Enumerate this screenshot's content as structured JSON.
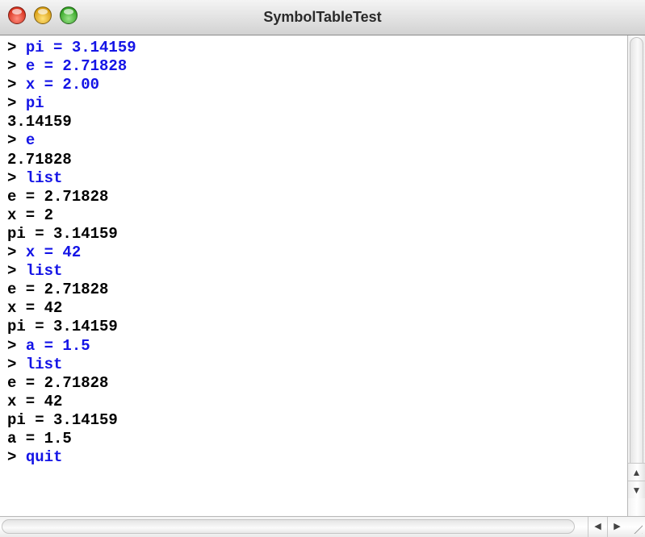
{
  "window": {
    "title": "SymbolTableTest"
  },
  "colors": {
    "input_text": "#1414e6",
    "output_text": "#000000",
    "background": "#ffffff"
  },
  "console": {
    "prompt": "> ",
    "lines": [
      {
        "type": "input",
        "text": "pi = 3.14159"
      },
      {
        "type": "input",
        "text": "e = 2.71828"
      },
      {
        "type": "input",
        "text": "x = 2.00"
      },
      {
        "type": "input",
        "text": "pi"
      },
      {
        "type": "output",
        "text": "3.14159"
      },
      {
        "type": "input",
        "text": "e"
      },
      {
        "type": "output",
        "text": "2.71828"
      },
      {
        "type": "input",
        "text": "list"
      },
      {
        "type": "output",
        "text": "e = 2.71828"
      },
      {
        "type": "output",
        "text": "x = 2"
      },
      {
        "type": "output",
        "text": "pi = 3.14159"
      },
      {
        "type": "input",
        "text": "x = 42"
      },
      {
        "type": "input",
        "text": "list"
      },
      {
        "type": "output",
        "text": "e = 2.71828"
      },
      {
        "type": "output",
        "text": "x = 42"
      },
      {
        "type": "output",
        "text": "pi = 3.14159"
      },
      {
        "type": "input",
        "text": "a = 1.5"
      },
      {
        "type": "input",
        "text": "list"
      },
      {
        "type": "output",
        "text": "e = 2.71828"
      },
      {
        "type": "output",
        "text": "x = 42"
      },
      {
        "type": "output",
        "text": "pi = 3.14159"
      },
      {
        "type": "output",
        "text": "a = 1.5"
      },
      {
        "type": "input",
        "text": "quit"
      }
    ]
  },
  "icons": {
    "close": "close-icon",
    "minimize": "minimize-icon",
    "zoom": "zoom-icon",
    "scroll_up": "arrow-up-icon",
    "scroll_down": "arrow-down-icon",
    "scroll_left": "arrow-left-icon",
    "scroll_right": "arrow-right-icon",
    "resize": "resize-grip-icon"
  }
}
